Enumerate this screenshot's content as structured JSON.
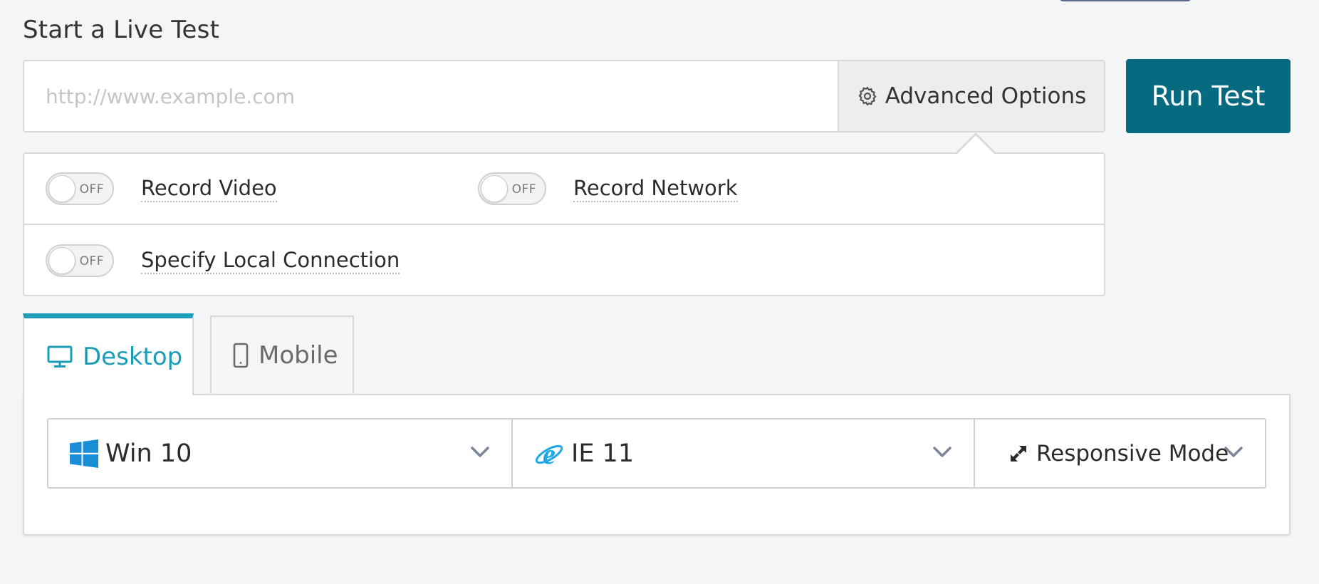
{
  "page": {
    "title": "Start a Live Test"
  },
  "url_bar": {
    "placeholder": "http://www.example.com",
    "value": "",
    "advanced_label": "Advanced Options"
  },
  "run_button": {
    "label": "Run Test"
  },
  "advanced_options": {
    "toggles": [
      {
        "label": "Record Video",
        "state": "OFF"
      },
      {
        "label": "Record Network",
        "state": "OFF"
      },
      {
        "label": "Specify Local Connection",
        "state": "OFF"
      }
    ]
  },
  "tabs": [
    {
      "label": "Desktop",
      "active": true,
      "icon": "monitor-icon"
    },
    {
      "label": "Mobile",
      "active": false,
      "icon": "phone-icon"
    }
  ],
  "selectors": {
    "os": {
      "value": "Win 10",
      "icon": "windows-logo-icon"
    },
    "browser": {
      "value": "IE 11",
      "icon": "ie-logo-icon"
    },
    "resolution": {
      "value": "Responsive Mode",
      "icon": "expand-arrows-icon"
    }
  },
  "colors": {
    "accent": "#1b9db7",
    "primary_button": "#066a80",
    "windows_blue": "#1a8fd8",
    "ie_blue": "#1fa8e8"
  }
}
